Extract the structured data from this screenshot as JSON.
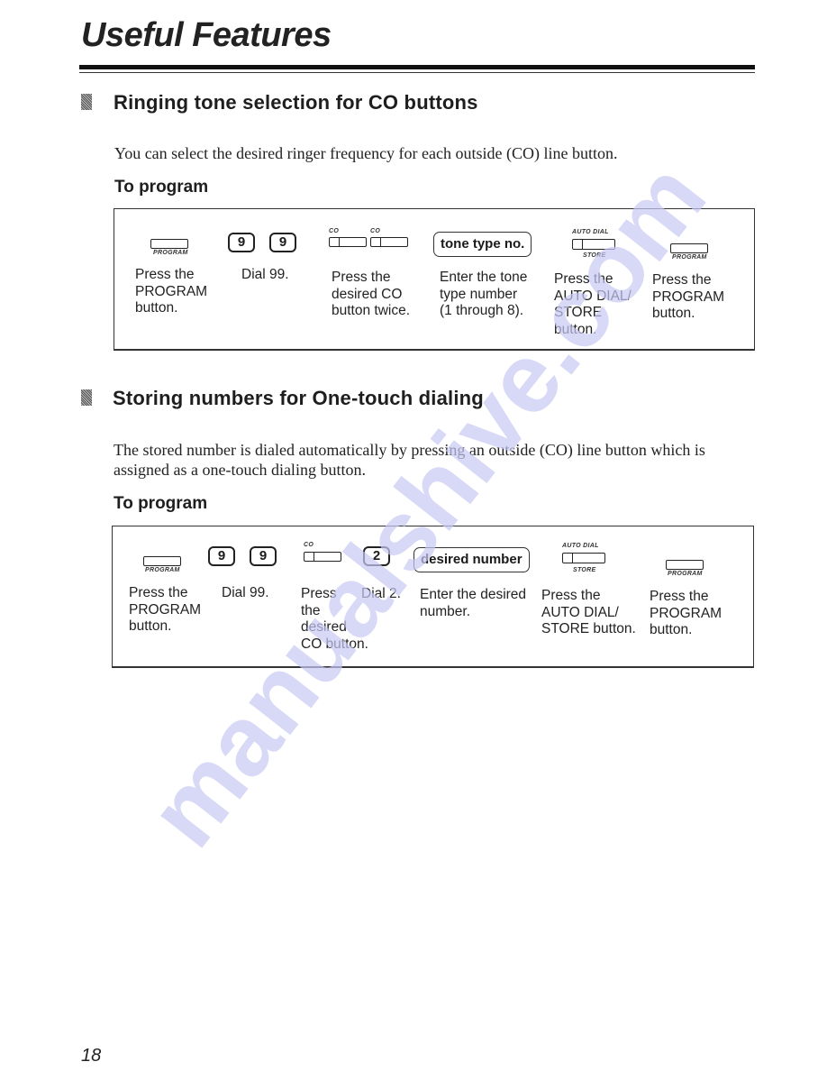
{
  "page": {
    "title": "Useful Features",
    "page_number": "18",
    "watermark": "manualshive.com"
  },
  "sections": [
    {
      "title": "Ringing tone selection for CO buttons",
      "intro": "You can select the desired ringer frequency for each outside (CO) line button.",
      "subhead": "To program",
      "keys": {
        "program_caption": "PROGRAM",
        "digit_1": "9",
        "digit_2": "9",
        "co_caption_1": "CO",
        "co_caption_2": "CO",
        "entry": "tone type no.",
        "auto_dial_caption": "AUTO DIAL",
        "store_caption": "STORE",
        "program_caption_end": "PROGRAM"
      },
      "steps": [
        "Press the\nPROGRAM\nbutton.",
        "Dial 99.",
        "Press the\ndesired CO\nbutton twice.",
        "Enter the tone\ntype number\n(1 through 8).",
        "Press the\nAUTO DIAL/\nSTORE\nbutton.",
        "Press the\nPROGRAM\nbutton."
      ]
    },
    {
      "title": "Storing numbers for One-touch dialing",
      "intro": "The stored number is dialed automatically by pressing an outside (CO) line button which is assigned as a one-touch dialing button.",
      "subhead": "To program",
      "keys": {
        "program_caption": "PROGRAM",
        "digit_1": "9",
        "digit_2": "9",
        "co_caption": "CO",
        "digit_3": "2",
        "entry": "desired number",
        "auto_dial_caption": "AUTO DIAL",
        "store_caption": "STORE",
        "program_caption_end": "PROGRAM"
      },
      "steps": [
        "Press the\nPROGRAM\nbutton.",
        "Dial 99.",
        "Press\nthe\ndesired\nCO button.",
        "Dial 2.",
        "Enter the desired\nnumber.",
        "Press the\nAUTO DIAL/\nSTORE button.",
        "Press the\nPROGRAM\nbutton."
      ]
    }
  ]
}
